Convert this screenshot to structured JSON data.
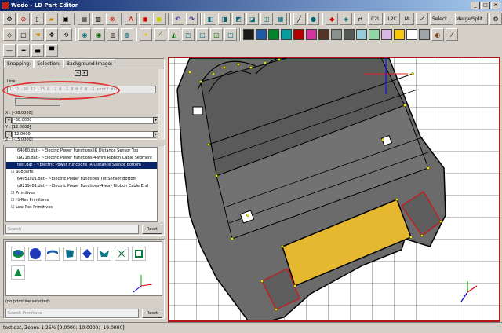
{
  "window": {
    "title": "Wedo - LD Part Editor"
  },
  "toolbar_text_buttons": {
    "c2l": "C2L",
    "l2c": "L2C",
    "ml": "ML",
    "select": "Select...",
    "merge_split": "Merge/Split..."
  },
  "tabs": [
    "Snapping:",
    "Selection:",
    "Background Image:"
  ],
  "line_panel": {
    "label": "Line:",
    "value": "11 2 -38 12 -15 0 -1 0 -1 0 0 0 0 -1 rect3.dat",
    "x_label": "X : [-38.0000]",
    "x_value": "-38.0000",
    "y_label": "Y : [12.0000]",
    "y_value": "12.0000",
    "z_label": "Z : [-15.0000]"
  },
  "parts_list": {
    "items": [
      {
        "text": "64060.dat - ~Electric Power Functions IR Distance Sensor Top",
        "type": "item",
        "selected": false
      },
      {
        "text": "u9218.dat - ~Electric Power Functions 4-Wire Ribbon Cable Segment",
        "type": "item",
        "selected": false
      },
      {
        "text": "test.dat - ~Electric Power Functions IR Distance Sensor Bottom",
        "type": "item",
        "selected": true
      },
      {
        "text": "Subparts",
        "type": "cat",
        "selected": false
      },
      {
        "text": "64051s01.dat - ~Electric Power Functions Tilt Sensor Bottom",
        "type": "item",
        "selected": false
      },
      {
        "text": "u9219s01.dat - ~Electric Power Functions 4-way Ribbon Cable End",
        "type": "item",
        "selected": false
      },
      {
        "text": "Primitives",
        "type": "cat",
        "selected": false
      },
      {
        "text": "Hi-Res Primitives",
        "type": "cat",
        "selected": false
      },
      {
        "text": "Low-Res Primitives",
        "type": "cat",
        "selected": false
      }
    ],
    "search_placeholder": "Search",
    "reset_label": "Reset"
  },
  "primitives": {
    "status": "(no primitive selected)",
    "search_placeholder": "Search Primitives",
    "reset_label": "Reset"
  },
  "status_bar": "test.dat, Zoom: 1.25% [9.0000; 10.0000; -19.0000]",
  "colors": {
    "palette": [
      "#1b1b1b",
      "#1e5aa8",
      "#00852b",
      "#069d9f",
      "#b40000",
      "#d3359d",
      "#543324",
      "#8a928d",
      "#545955",
      "#97cbd9",
      "#8fd8a6",
      "#d9b6e3",
      "#fac80a",
      "#ffffff",
      "#a0a5a9"
    ],
    "accent_red": "#b01818",
    "part_gray": "#6b6b6b",
    "part_yellow": "#e6b830"
  }
}
